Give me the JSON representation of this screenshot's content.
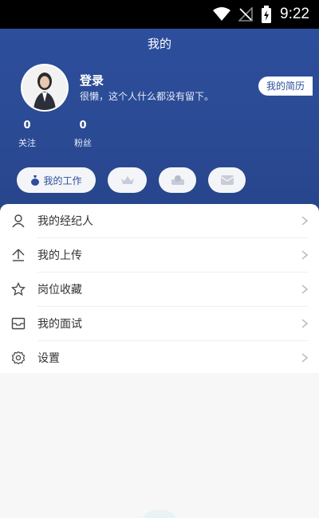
{
  "status_bar": {
    "time": "9:22"
  },
  "header": {
    "title": "我的",
    "login_label": "登录",
    "bio": "很懒，这个人什么都没有留下。",
    "resume_button": "我的简历",
    "stats": [
      {
        "value": "0",
        "label": "关注"
      },
      {
        "value": "0",
        "label": "粉丝"
      }
    ],
    "quick_work_label": "我的工作"
  },
  "menu": {
    "items": [
      {
        "label": "我的经纪人",
        "icon": "person-icon"
      },
      {
        "label": "我的上传",
        "icon": "upload-icon"
      },
      {
        "label": "岗位收藏",
        "icon": "star-icon"
      },
      {
        "label": "我的面试",
        "icon": "inbox-icon"
      },
      {
        "label": "设置",
        "icon": "gear-icon"
      }
    ]
  },
  "colors": {
    "brand": "#2d4e9c",
    "background": "#f7f7f7"
  }
}
